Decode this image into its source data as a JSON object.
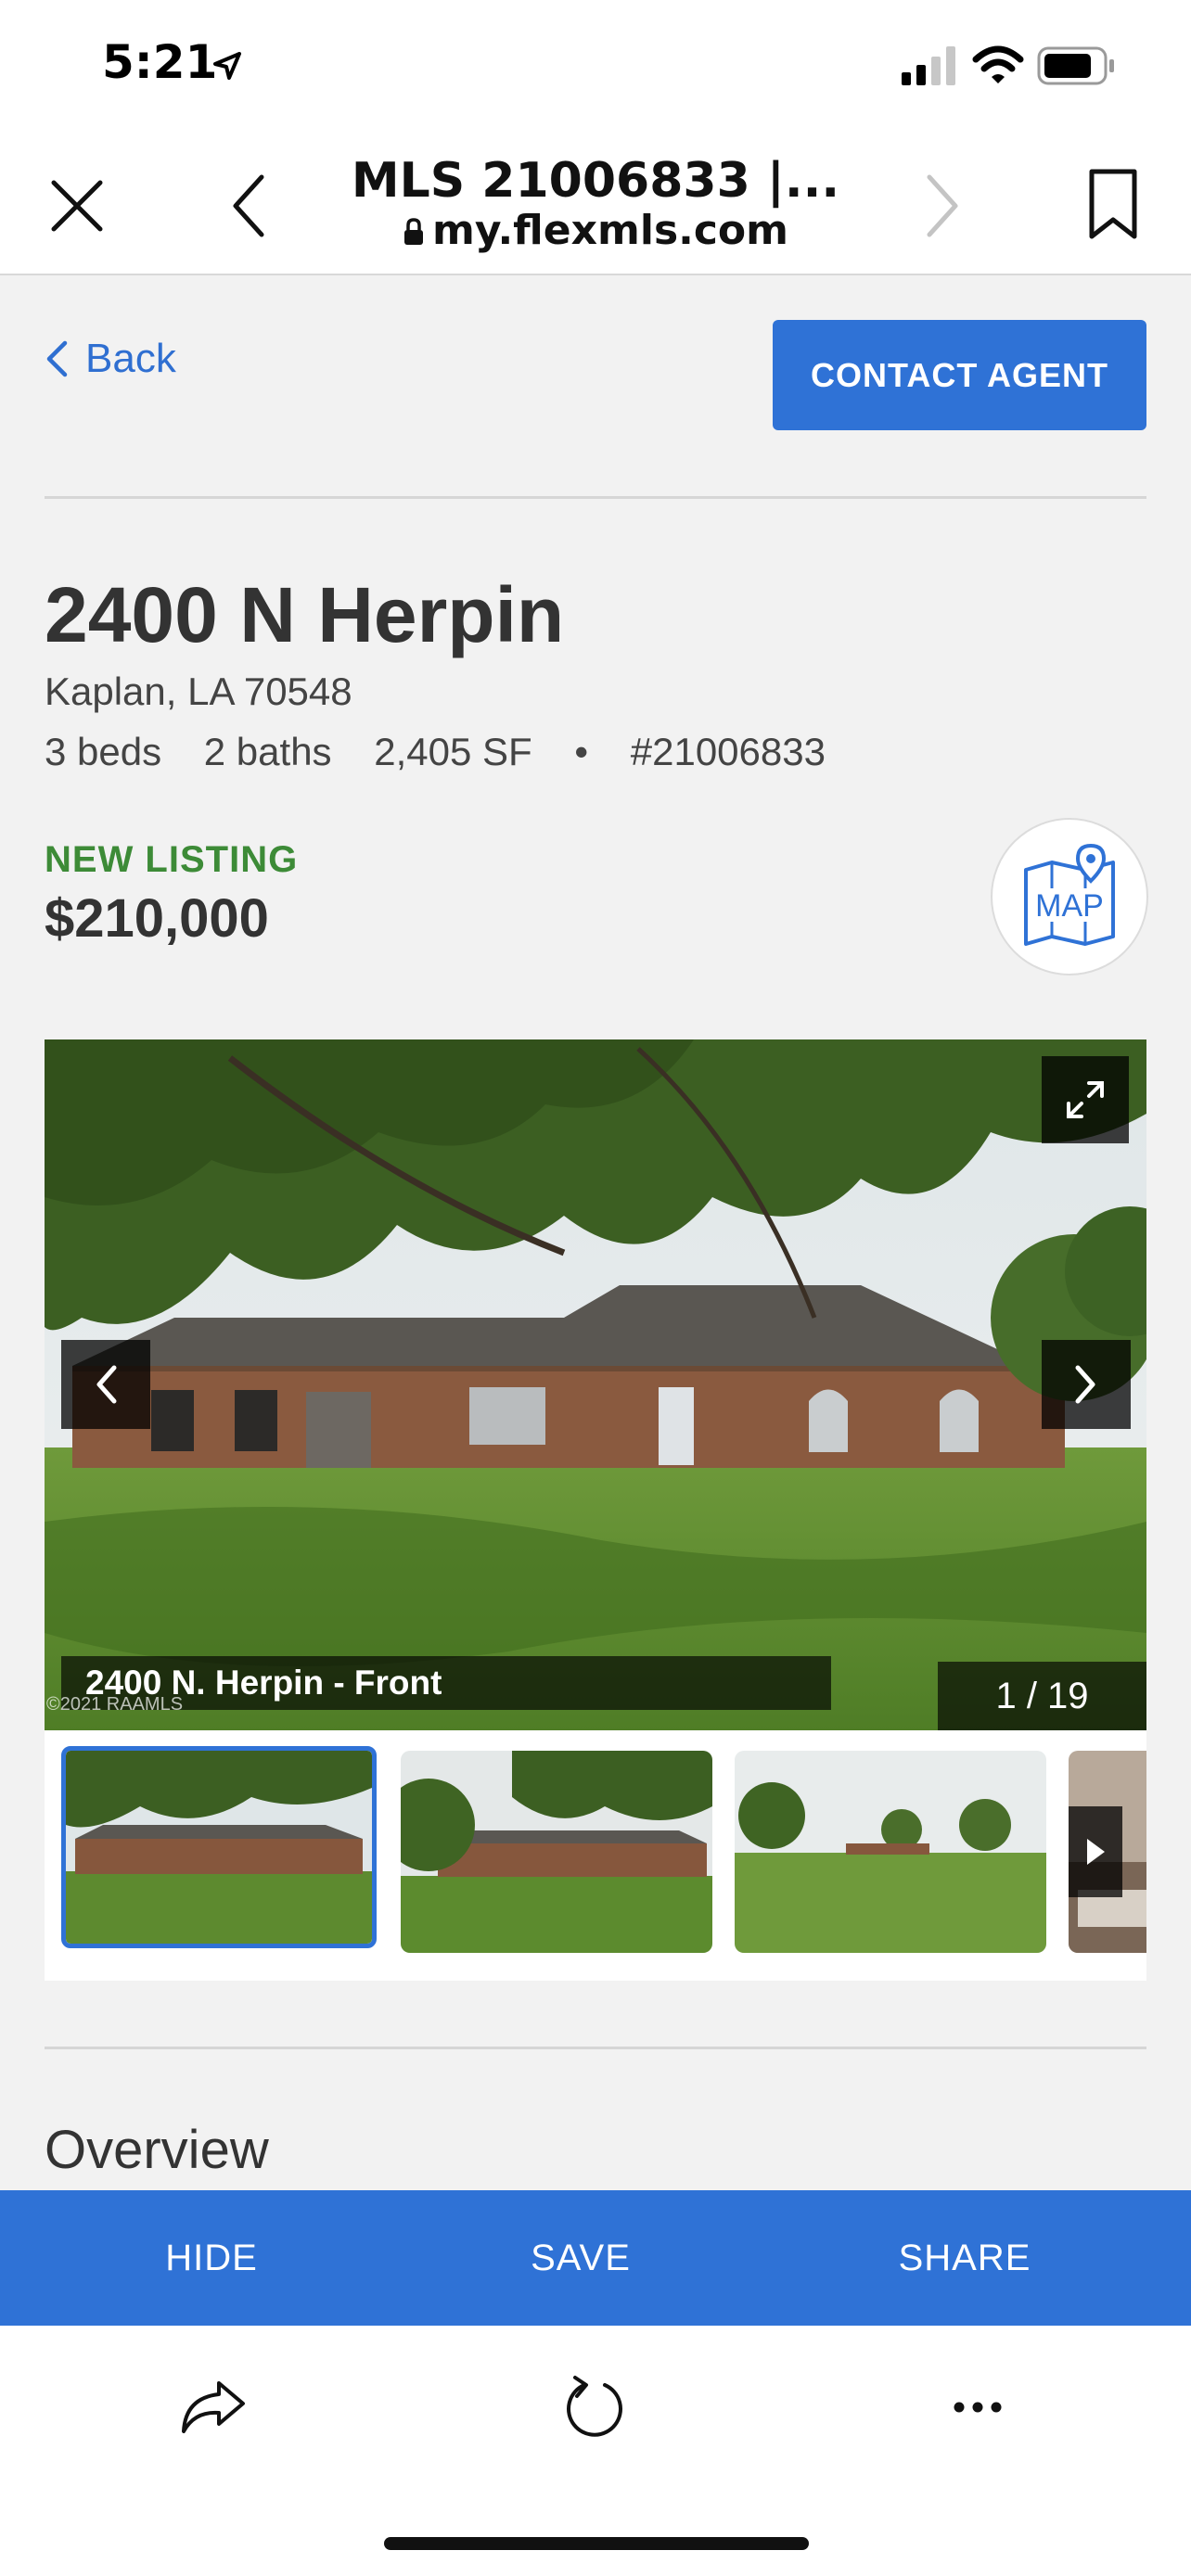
{
  "status_bar": {
    "time": "5:21"
  },
  "browser": {
    "title": "MLS 21006833 |...",
    "domain": "my.flexmls.com"
  },
  "nav": {
    "back_label": "Back",
    "contact_label": "CONTACT AGENT"
  },
  "listing": {
    "street": "2400 N Herpin",
    "city_state_zip": "Kaplan, LA 70548",
    "beds": "3 beds",
    "baths": "2 baths",
    "area": "2,405 SF",
    "separator": "•",
    "mls_number": "#21006833",
    "status": "NEW LISTING",
    "price": "$210,000",
    "map_label": "MAP"
  },
  "gallery": {
    "caption": "2400 N. Herpin - Front",
    "counter": "1 / 19",
    "copyright": "©2021 RAAMLS"
  },
  "overview_heading": "Overview",
  "actions": {
    "hide": "HIDE",
    "save": "SAVE",
    "share": "SHARE"
  },
  "colors": {
    "accent": "#2f72d6",
    "status_green": "#3d8b37",
    "text": "#333333"
  }
}
